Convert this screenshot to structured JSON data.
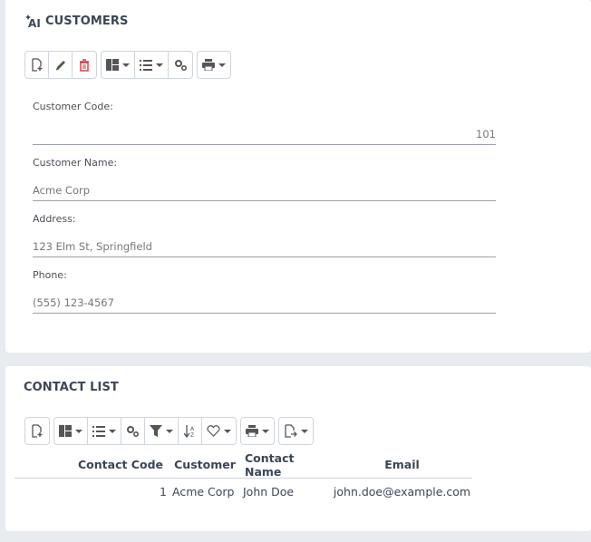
{
  "customers_panel": {
    "title": "CUSTOMERS",
    "fields": [
      {
        "label": "Customer Code:",
        "value": "101"
      },
      {
        "label": "Customer Name:",
        "value": "Acme Corp"
      },
      {
        "label": "Address:",
        "value": "123 Elm St, Springfield"
      },
      {
        "label": "Phone:",
        "value": "(555) 123-4567"
      }
    ]
  },
  "contact_panel": {
    "title": "CONTACT LIST",
    "columns": [
      "Contact Code",
      "Customer",
      "Contact Name",
      "Email"
    ],
    "rows": [
      [
        "1",
        "Acme Corp",
        "John Doe",
        "john.doe@example.com"
      ]
    ]
  },
  "colors": {
    "title": "#3b4656",
    "delete_icon": "#d9363e",
    "background": "#e8ecf1"
  },
  "icons": [
    "ai-icon",
    "new-document-icon",
    "edit-pencil-icon",
    "delete-trash-icon",
    "layout-icon",
    "list-icon",
    "settings-gears-icon",
    "print-icon",
    "filter-icon",
    "sort-az-icon",
    "favorite-heart-icon",
    "export-icon"
  ]
}
